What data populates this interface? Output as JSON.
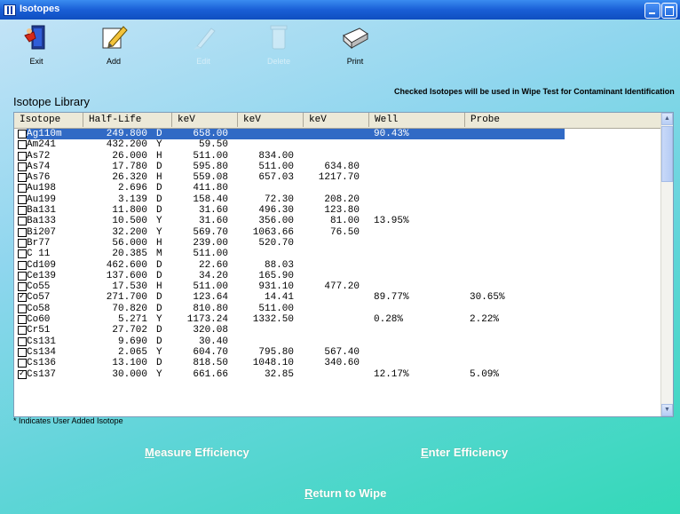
{
  "window": {
    "title": "Isotopes"
  },
  "toolbar": [
    {
      "label": "Exit",
      "icon": "exit-door-icon",
      "enabled": true
    },
    {
      "label": "Add",
      "icon": "pencil-add-icon",
      "enabled": true
    },
    {
      "label": "Edit",
      "icon": "edit-brush-icon",
      "enabled": false
    },
    {
      "label": "Delete",
      "icon": "trash-can-icon",
      "enabled": false
    },
    {
      "label": "Print",
      "icon": "printer-hand-icon",
      "enabled": true
    }
  ],
  "library_title": "Isotope Library",
  "note": "Checked Isotopes will be used in Wipe Test for Contaminant Identification",
  "table": {
    "columns": [
      "Isotope",
      "Half-Life",
      "keV",
      "keV",
      "keV",
      "Well",
      "Probe"
    ],
    "rows": [
      {
        "checked": false,
        "isotope": "Ag110m",
        "half": "249.800",
        "unit": "D",
        "kev1": "658.00",
        "kev2": "",
        "kev3": "",
        "well": "90.43%",
        "probe": "",
        "selected": true
      },
      {
        "checked": false,
        "isotope": "Am241",
        "half": "432.200",
        "unit": "Y",
        "kev1": "59.50",
        "kev2": "",
        "kev3": "",
        "well": "",
        "probe": ""
      },
      {
        "checked": false,
        "isotope": "As72",
        "half": "26.000",
        "unit": "H",
        "kev1": "511.00",
        "kev2": "834.00",
        "kev3": "",
        "well": "",
        "probe": ""
      },
      {
        "checked": false,
        "isotope": "As74",
        "half": "17.780",
        "unit": "D",
        "kev1": "595.80",
        "kev2": "511.00",
        "kev3": "634.80",
        "well": "",
        "probe": ""
      },
      {
        "checked": false,
        "isotope": "As76",
        "half": "26.320",
        "unit": "H",
        "kev1": "559.08",
        "kev2": "657.03",
        "kev3": "1217.70",
        "well": "",
        "probe": ""
      },
      {
        "checked": false,
        "isotope": "Au198",
        "half": "2.696",
        "unit": "D",
        "kev1": "411.80",
        "kev2": "",
        "kev3": "",
        "well": "",
        "probe": ""
      },
      {
        "checked": false,
        "isotope": "Au199",
        "half": "3.139",
        "unit": "D",
        "kev1": "158.40",
        "kev2": "72.30",
        "kev3": "208.20",
        "well": "",
        "probe": ""
      },
      {
        "checked": false,
        "isotope": "Ba131",
        "half": "11.800",
        "unit": "D",
        "kev1": "31.60",
        "kev2": "496.30",
        "kev3": "123.80",
        "well": "",
        "probe": ""
      },
      {
        "checked": false,
        "isotope": "Ba133",
        "half": "10.500",
        "unit": "Y",
        "kev1": "31.60",
        "kev2": "356.00",
        "kev3": "81.00",
        "well": "13.95%",
        "probe": ""
      },
      {
        "checked": false,
        "isotope": "Bi207",
        "half": "32.200",
        "unit": "Y",
        "kev1": "569.70",
        "kev2": "1063.66",
        "kev3": "76.50",
        "well": "",
        "probe": ""
      },
      {
        "checked": false,
        "isotope": "Br77",
        "half": "56.000",
        "unit": "H",
        "kev1": "239.00",
        "kev2": "520.70",
        "kev3": "",
        "well": "",
        "probe": ""
      },
      {
        "checked": false,
        "isotope": "C 11",
        "half": "20.385",
        "unit": "M",
        "kev1": "511.00",
        "kev2": "",
        "kev3": "",
        "well": "",
        "probe": ""
      },
      {
        "checked": false,
        "isotope": "Cd109",
        "half": "462.600",
        "unit": "D",
        "kev1": "22.60",
        "kev2": "88.03",
        "kev3": "",
        "well": "",
        "probe": ""
      },
      {
        "checked": false,
        "isotope": "Ce139",
        "half": "137.600",
        "unit": "D",
        "kev1": "34.20",
        "kev2": "165.90",
        "kev3": "",
        "well": "",
        "probe": ""
      },
      {
        "checked": false,
        "isotope": "Co55",
        "half": "17.530",
        "unit": "H",
        "kev1": "511.00",
        "kev2": "931.10",
        "kev3": "477.20",
        "well": "",
        "probe": ""
      },
      {
        "checked": true,
        "isotope": "Co57",
        "half": "271.700",
        "unit": "D",
        "kev1": "123.64",
        "kev2": "14.41",
        "kev3": "",
        "well": "89.77%",
        "probe": "30.65%"
      },
      {
        "checked": false,
        "isotope": "Co58",
        "half": "70.820",
        "unit": "D",
        "kev1": "810.80",
        "kev2": "511.00",
        "kev3": "",
        "well": "",
        "probe": ""
      },
      {
        "checked": false,
        "isotope": "Co60",
        "half": "5.271",
        "unit": "Y",
        "kev1": "1173.24",
        "kev2": "1332.50",
        "kev3": "",
        "well": "0.28%",
        "probe": "2.22%"
      },
      {
        "checked": false,
        "isotope": "Cr51",
        "half": "27.702",
        "unit": "D",
        "kev1": "320.08",
        "kev2": "",
        "kev3": "",
        "well": "",
        "probe": ""
      },
      {
        "checked": false,
        "isotope": "Cs131",
        "half": "9.690",
        "unit": "D",
        "kev1": "30.40",
        "kev2": "",
        "kev3": "",
        "well": "",
        "probe": ""
      },
      {
        "checked": false,
        "isotope": "Cs134",
        "half": "2.065",
        "unit": "Y",
        "kev1": "604.70",
        "kev2": "795.80",
        "kev3": "567.40",
        "well": "",
        "probe": ""
      },
      {
        "checked": false,
        "isotope": "Cs136",
        "half": "13.100",
        "unit": "D",
        "kev1": "818.50",
        "kev2": "1048.10",
        "kev3": "340.60",
        "well": "",
        "probe": ""
      },
      {
        "checked": true,
        "isotope": "Cs137",
        "half": "30.000",
        "unit": "Y",
        "kev1": "661.66",
        "kev2": "32.85",
        "kev3": "",
        "well": "12.17%",
        "probe": "5.09%"
      }
    ]
  },
  "footnote": "* Indicates User Added Isotope",
  "buttons": {
    "measure": {
      "first": "M",
      "rest": "easure Efficiency"
    },
    "enter": {
      "first": "E",
      "rest": "nter Efficiency"
    },
    "ret": {
      "first": "R",
      "rest": "eturn to Wipe"
    }
  }
}
